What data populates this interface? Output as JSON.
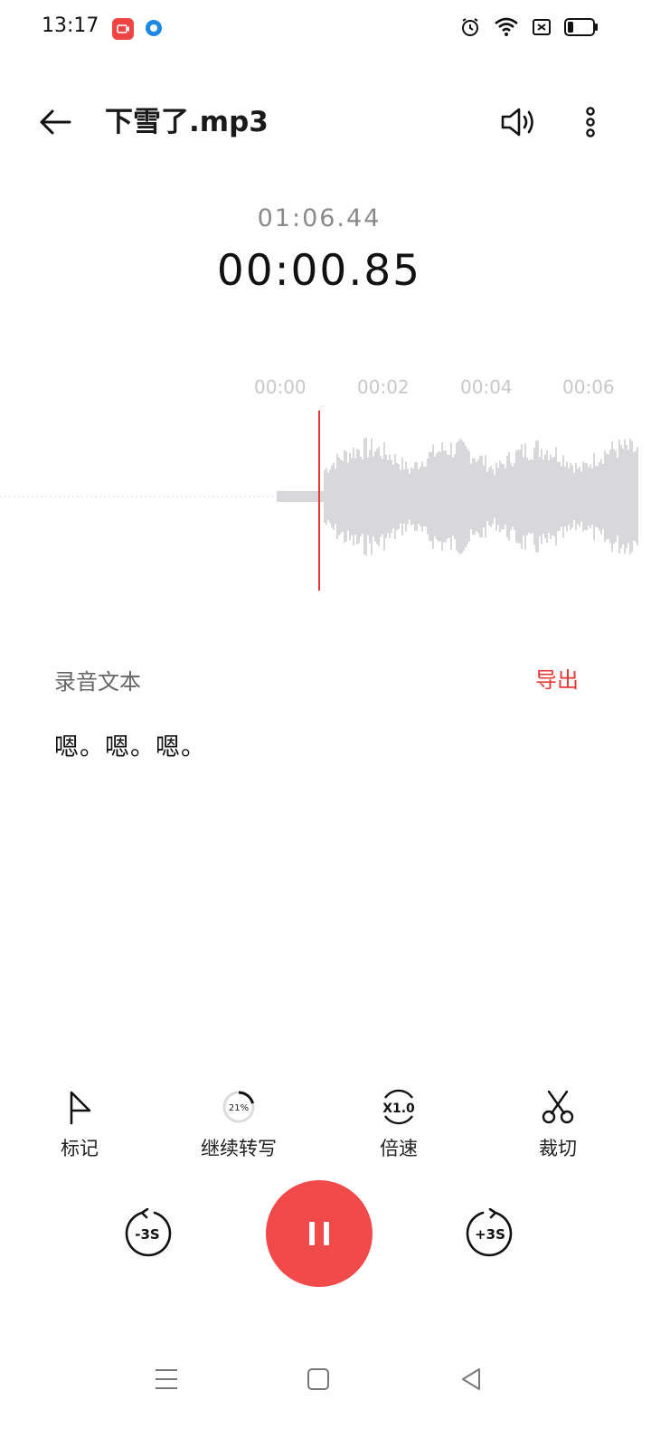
{
  "status_bar": {
    "time": "13:17"
  },
  "header": {
    "title": "下雪了.mp3"
  },
  "player": {
    "total_time": "01:06.44",
    "current_time": "00:00.85",
    "ticks": [
      "00:00",
      "00:02",
      "00:04",
      "00:06"
    ]
  },
  "transcript": {
    "label": "录音文本",
    "export_label": "导出",
    "text": "嗯。嗯。嗯。"
  },
  "tools": {
    "mark": "标记",
    "continue": "继续转写",
    "progress": "21%",
    "progress_fraction": 0.21,
    "speed": "倍速",
    "speed_value": "X1.0",
    "cut": "裁切"
  },
  "skip": {
    "back": "-3S",
    "forward": "+3S"
  },
  "colors": {
    "accent": "#f24a4a",
    "export": "#e53935",
    "wave": "#d8d8da",
    "playhead": "#e53935"
  }
}
